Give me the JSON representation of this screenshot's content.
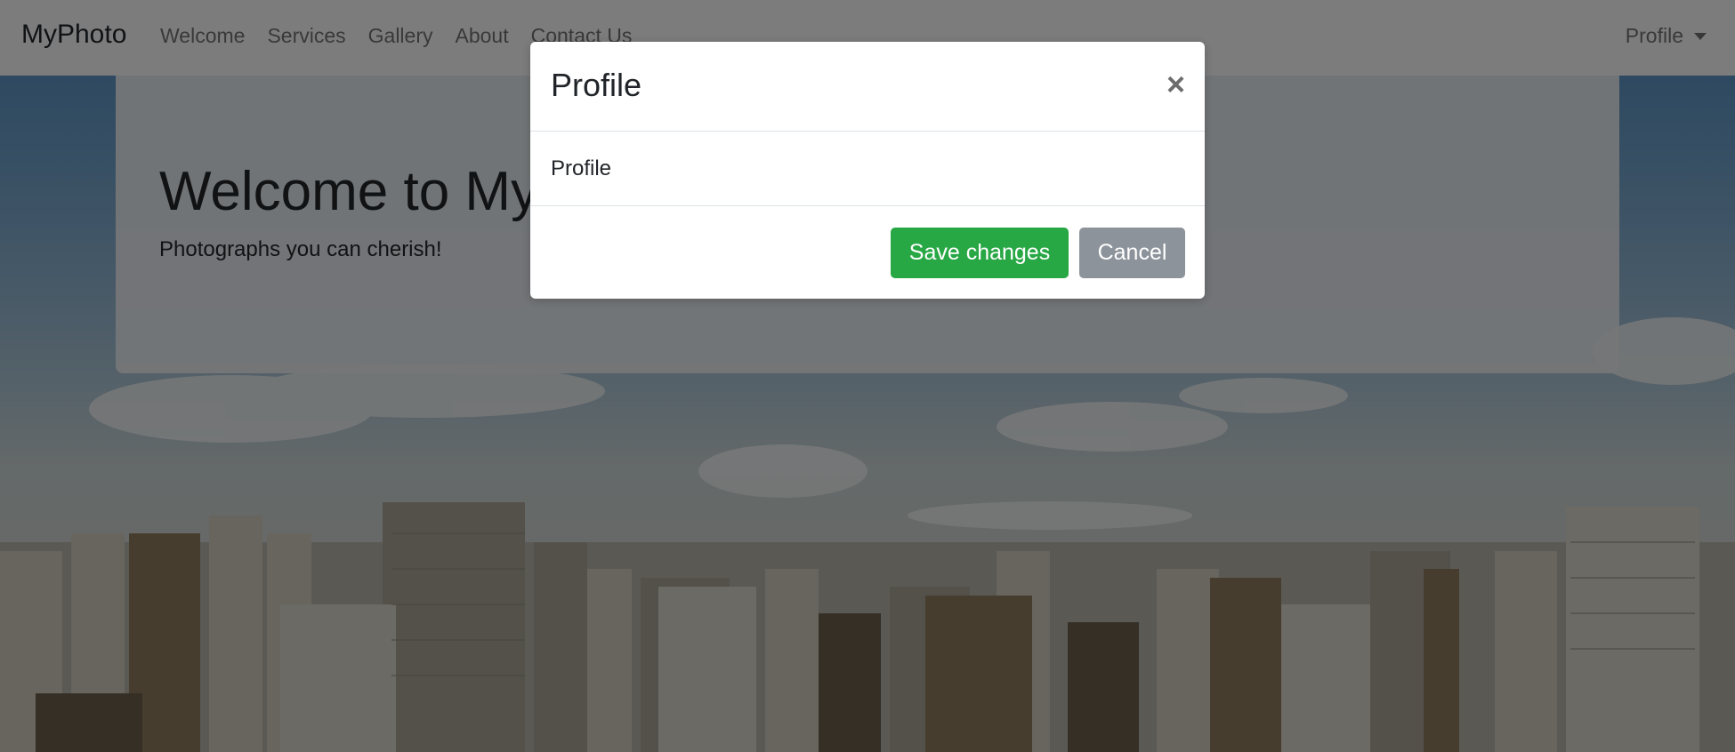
{
  "navbar": {
    "brand": "MyPhoto",
    "links": [
      "Welcome",
      "Services",
      "Gallery",
      "About",
      "Contact Us"
    ],
    "profile_label": "Profile"
  },
  "jumbotron": {
    "title": "Welcome to MyPhoto",
    "subtitle": "Photographs you can cherish!"
  },
  "modal": {
    "title": "Profile",
    "close_glyph": "×",
    "body_text": "Profile",
    "save_label": "Save changes",
    "cancel_label": "Cancel"
  },
  "colors": {
    "save_button": "#28a745",
    "cancel_button": "#8d939a",
    "navbar_bg": "#f8f9fa"
  }
}
